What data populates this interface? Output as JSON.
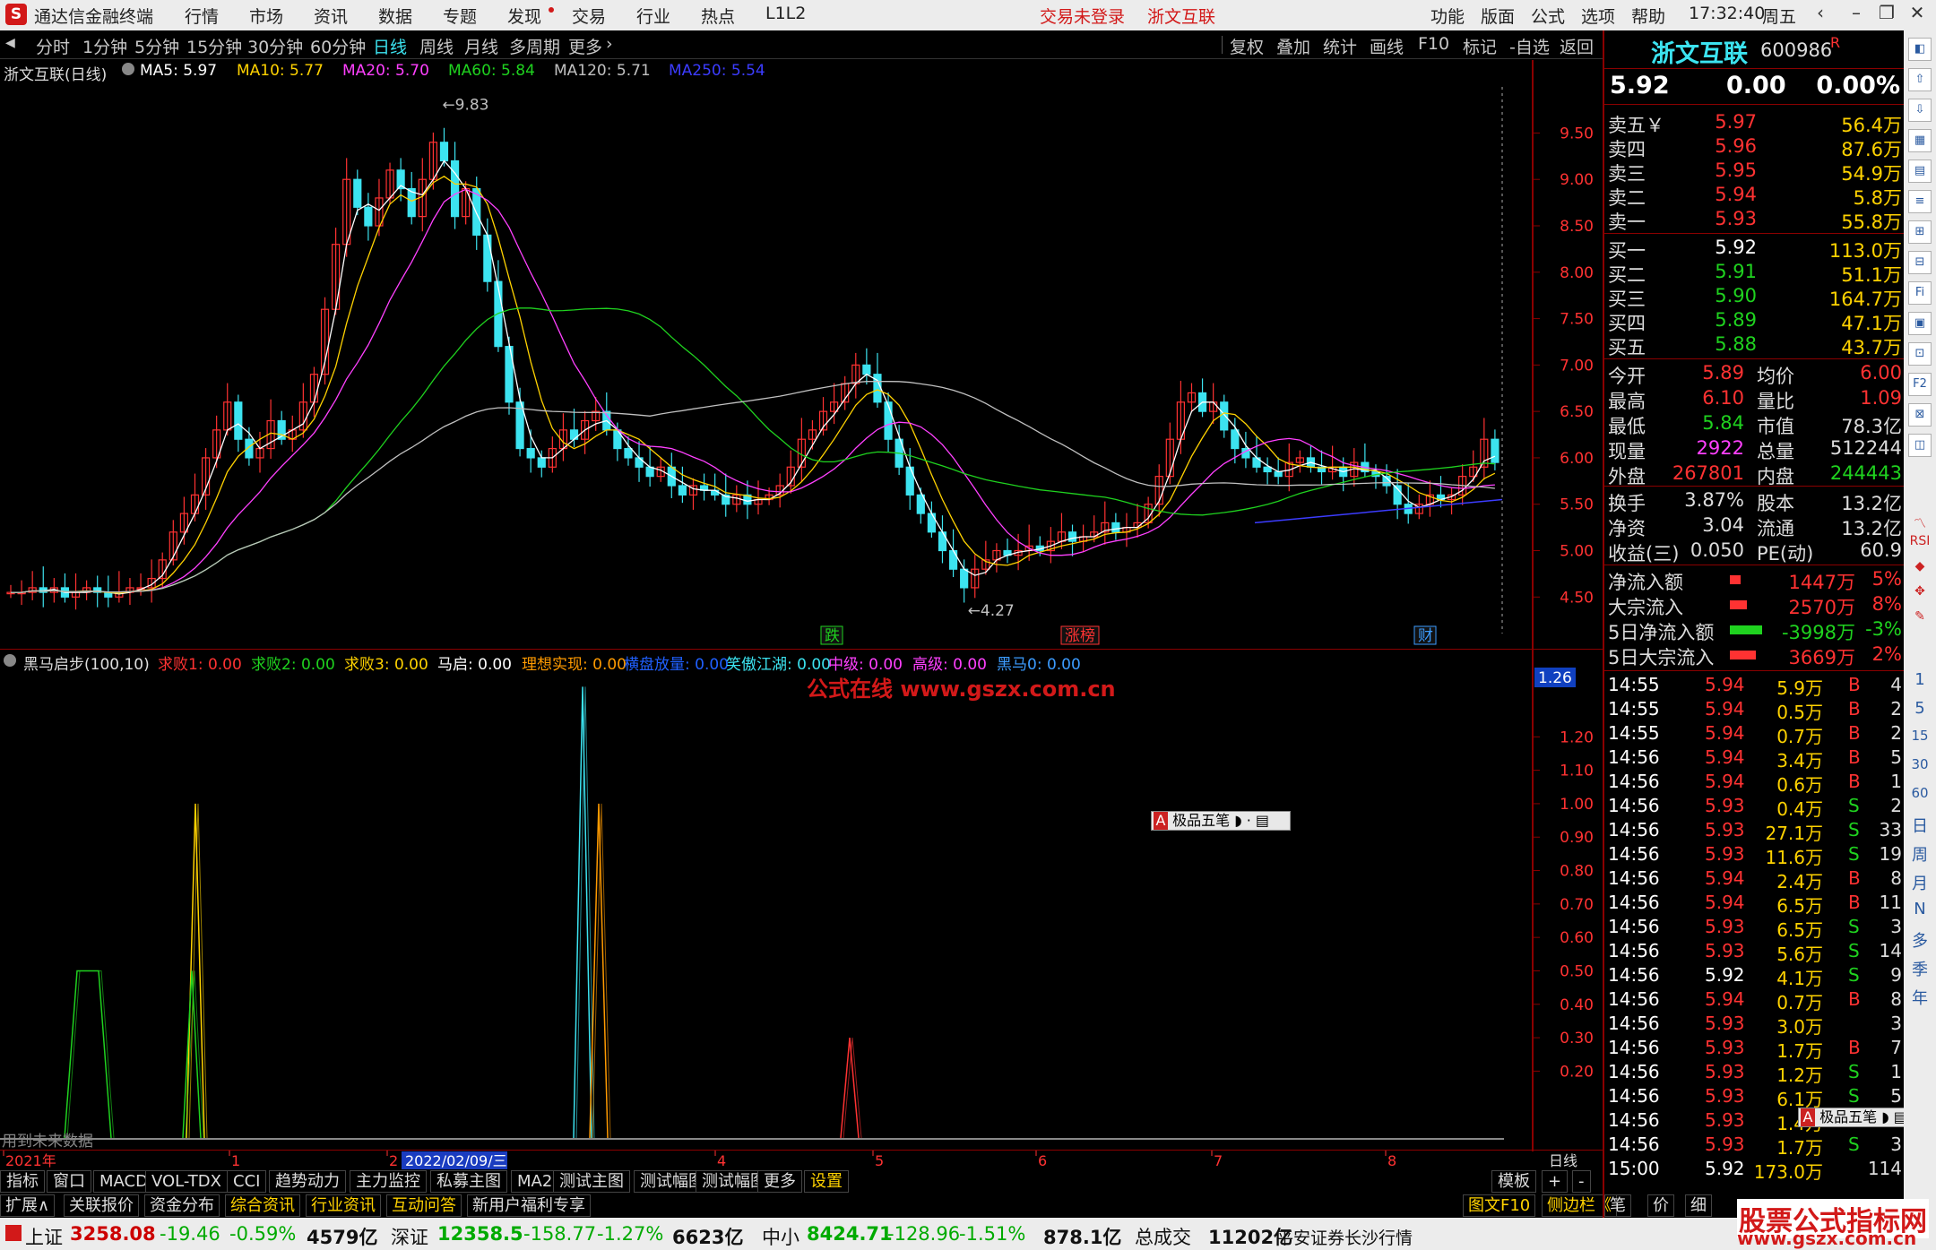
{
  "app": {
    "title": "通达信金融终端",
    "menu": [
      "行情",
      "市场",
      "资讯",
      "数据",
      "专题",
      "发现",
      "交易",
      "行业",
      "热点",
      "L1L2"
    ],
    "trade_status": "交易未登录",
    "broker_name": "浙文互联",
    "right_menu": [
      "功能",
      "版面",
      "公式",
      "选项",
      "帮助"
    ],
    "clock": "17:32:40",
    "weekday": "周五"
  },
  "toolbar": {
    "periods": [
      "分时",
      "1分钟",
      "5分钟",
      "15分钟",
      "30分钟",
      "60分钟",
      "日线",
      "周线",
      "月线",
      "多周期",
      "更多"
    ],
    "active_period": "日线",
    "right_buttons": [
      "复权",
      "叠加",
      "统计",
      "画线",
      "F10",
      "标记",
      "-自选",
      "返回"
    ]
  },
  "main_chart": {
    "header": "浙文互联(日线)",
    "ma": [
      {
        "label": "MA5: 5.97",
        "color": "#ffffff"
      },
      {
        "label": "MA10: 5.77",
        "color": "#ffd200"
      },
      {
        "label": "MA20: 5.70",
        "color": "#ff40ff"
      },
      {
        "label": "MA60: 5.84",
        "color": "#1fd21f"
      },
      {
        "label": "MA120: 5.71",
        "color": "#c0c0c0"
      },
      {
        "label": "MA250: 5.54",
        "color": "#3c3cff"
      }
    ],
    "y_ticks": [
      "9.50",
      "9.00",
      "8.50",
      "8.00",
      "7.50",
      "7.00",
      "6.50",
      "6.00",
      "5.50",
      "5.00",
      "4.50"
    ],
    "high_label": "9.83",
    "low_label": "4.27",
    "markers": [
      "跌",
      "涨榜",
      "财"
    ],
    "watermark": "公式在线 www.gszx.com.cn"
  },
  "indicator": {
    "header": "黑马启步(100,10)",
    "items": [
      {
        "label": "求败1: 0.00",
        "color": "#ff3232"
      },
      {
        "label": "求败2: 0.00",
        "color": "#1fd21f"
      },
      {
        "label": "求败3: 0.00",
        "color": "#ffd200"
      },
      {
        "label": "马启: 0.00",
        "color": "#ffffff"
      },
      {
        "label": "理想实现: 0.00",
        "color": "#ff9a00"
      },
      {
        "label": "横盘放量: 0.00",
        "color": "#2060ff"
      },
      {
        "label": "笑傲江湖: 0.00",
        "color": "#3ce3f0"
      },
      {
        "label": "中级: 0.00",
        "color": "#ff40ff"
      },
      {
        "label": "高级: 0.00",
        "color": "#ff40ff"
      },
      {
        "label": "黑马0: 0.00",
        "color": "#3c9cff"
      }
    ],
    "current_value": "1.26",
    "y_ticks": [
      "1.20",
      "1.10",
      "1.00",
      "0.90",
      "0.80",
      "0.70",
      "0.60",
      "0.50",
      "0.40",
      "0.30",
      "0.20"
    ],
    "footer_note": "用到未来数据",
    "float_toolbar": "极品五笔"
  },
  "date_axis": {
    "labels": [
      "2021年",
      "1",
      "2",
      "4",
      "5",
      "6",
      "7",
      "8"
    ],
    "cursor_date": "2022/02/09/三",
    "right_label": "日线"
  },
  "tabs": [
    "指标",
    "窗口",
    "MACD",
    "VOL-TDX",
    "CCI",
    "趋势动力",
    "主力监控",
    "私募主图",
    "MA2",
    "测试主图",
    "测试幅图A",
    "测试幅图B",
    "更多",
    "设置"
  ],
  "tabs_right": [
    "模板",
    "+",
    "-"
  ],
  "tabs2": [
    "扩展∧",
    "关联报价",
    "资金分布",
    "综合资讯",
    "行业资讯",
    "互动问答",
    "新用户福利专享"
  ],
  "tabs2_right": [
    "图文F10",
    "侧边栏《",
    "笔",
    "价",
    "细"
  ],
  "stock": {
    "name": "浙文互联",
    "code": "600986",
    "tag": "R",
    "price": "5.92",
    "change": "0.00",
    "change_pct": "0.00%",
    "asks": [
      {
        "label": "卖五￥",
        "price": "5.97",
        "vol": "56.4万"
      },
      {
        "label": "卖四",
        "price": "5.96",
        "vol": "87.6万"
      },
      {
        "label": "卖三",
        "price": "5.95",
        "vol": "54.9万"
      },
      {
        "label": "卖二",
        "price": "5.94",
        "vol": "5.8万"
      },
      {
        "label": "卖一",
        "price": "5.93",
        "vol": "55.8万"
      }
    ],
    "bids": [
      {
        "label": "买一",
        "price": "5.92",
        "vol": "113.0万"
      },
      {
        "label": "买二",
        "price": "5.91",
        "vol": "51.1万"
      },
      {
        "label": "买三",
        "price": "5.90",
        "vol": "164.7万"
      },
      {
        "label": "买四",
        "price": "5.89",
        "vol": "47.1万"
      },
      {
        "label": "买五",
        "price": "5.88",
        "vol": "43.7万"
      }
    ],
    "stats": [
      {
        "l1": "今开",
        "v1": "5.89",
        "c1": "#ff3232",
        "l2": "均价",
        "v2": "6.00",
        "c2": "#ff3232"
      },
      {
        "l1": "最高",
        "v1": "6.10",
        "c1": "#ff3232",
        "l2": "量比",
        "v2": "1.09",
        "c2": "#ff3232"
      },
      {
        "l1": "最低",
        "v1": "5.84",
        "c1": "#1fd21f",
        "l2": "市值",
        "v2": "78.3亿",
        "c2": "#dddddd"
      },
      {
        "l1": "现量",
        "v1": "2922",
        "c1": "#ff40ff",
        "l2": "总量",
        "v2": "512244",
        "c2": "#dddddd"
      },
      {
        "l1": "外盘",
        "v1": "267801",
        "c1": "#ff3232",
        "l2": "内盘",
        "v2": "244443",
        "c2": "#1fd21f"
      }
    ],
    "stats2": [
      {
        "l1": "换手",
        "v1": "3.87%",
        "l2": "股本",
        "v2": "13.2亿"
      },
      {
        "l1": "净资",
        "v1": "3.04",
        "l2": "流通",
        "v2": "13.2亿"
      },
      {
        "l1": "收益(三)",
        "v1": "0.050",
        "l2": "PE(动)",
        "v2": "60.9"
      }
    ],
    "flows": [
      {
        "label": "净流入额",
        "value": "1447万",
        "pct": "5%",
        "color": "#ff3232",
        "bar": 0.05
      },
      {
        "label": "大宗流入",
        "value": "2570万",
        "pct": "8%",
        "color": "#ff3232",
        "bar": 0.08
      },
      {
        "label": "5日净流入额",
        "value": "-3998万",
        "pct": "-3%",
        "color": "#1fd21f",
        "bar": 0.15
      },
      {
        "label": "5日大宗流入",
        "value": "3669万",
        "pct": "2%",
        "color": "#ff3232",
        "bar": 0.12
      }
    ],
    "ticks": [
      {
        "t": "14:55",
        "p": "5.94",
        "v": "5.9万",
        "s": "B",
        "n": "4"
      },
      {
        "t": "14:55",
        "p": "5.94",
        "v": "0.5万",
        "s": "B",
        "n": "2"
      },
      {
        "t": "14:55",
        "p": "5.94",
        "v": "0.7万",
        "s": "B",
        "n": "2"
      },
      {
        "t": "14:56",
        "p": "5.94",
        "v": "3.4万",
        "s": "B",
        "n": "5"
      },
      {
        "t": "14:56",
        "p": "5.94",
        "v": "0.6万",
        "s": "B",
        "n": "1"
      },
      {
        "t": "14:56",
        "p": "5.93",
        "v": "0.4万",
        "s": "S",
        "n": "2"
      },
      {
        "t": "14:56",
        "p": "5.93",
        "v": "27.1万",
        "s": "S",
        "n": "33"
      },
      {
        "t": "14:56",
        "p": "5.93",
        "v": "11.6万",
        "s": "S",
        "n": "19"
      },
      {
        "t": "14:56",
        "p": "5.94",
        "v": "2.4万",
        "s": "B",
        "n": "8"
      },
      {
        "t": "14:56",
        "p": "5.94",
        "v": "6.5万",
        "s": "B",
        "n": "11"
      },
      {
        "t": "14:56",
        "p": "5.93",
        "v": "6.5万",
        "s": "S",
        "n": "3"
      },
      {
        "t": "14:56",
        "p": "5.93",
        "v": "5.6万",
        "s": "S",
        "n": "14"
      },
      {
        "t": "14:56",
        "p": "5.92",
        "v": "4.1万",
        "s": "S",
        "n": "9"
      },
      {
        "t": "14:56",
        "p": "5.94",
        "v": "0.7万",
        "s": "B",
        "n": "8"
      },
      {
        "t": "14:56",
        "p": "5.93",
        "v": "3.0万",
        "s": "",
        "n": "3"
      },
      {
        "t": "14:56",
        "p": "5.93",
        "v": "1.7万",
        "s": "B",
        "n": "7"
      },
      {
        "t": "14:56",
        "p": "5.93",
        "v": "1.2万",
        "s": "S",
        "n": "1"
      },
      {
        "t": "14:56",
        "p": "5.93",
        "v": "6.1万",
        "s": "S",
        "n": "5"
      },
      {
        "t": "14:56",
        "p": "5.93",
        "v": "1.4万",
        "s": "",
        "n": ""
      },
      {
        "t": "14:56",
        "p": "5.93",
        "v": "1.7万",
        "s": "S",
        "n": "3"
      },
      {
        "t": "15:00",
        "p": "5.92",
        "v": "173.0万",
        "s": "",
        "n": "114"
      }
    ]
  },
  "side_tools": [
    "1",
    "5",
    "15",
    "30",
    "60",
    "日",
    "周",
    "月",
    "N",
    "多",
    "季",
    "年"
  ],
  "status": {
    "items": [
      {
        "name": "上证",
        "value": "3258.08",
        "chg": "-19.46",
        "pct": "-0.59%",
        "amt": "4579亿"
      },
      {
        "name": "深证",
        "value": "12358.5",
        "chg": "-158.77",
        "pct": "-1.27%",
        "amt": "6623亿"
      },
      {
        "name": "中小",
        "value": "8424.71",
        "chg": "-128.96",
        "pct": "-1.51%",
        "amt": "878.1亿"
      }
    ],
    "total_label": "总成交",
    "total_value": "11202亿",
    "broker_line": "平安证券长沙行情"
  },
  "corner_watermark": "股票公式指标网",
  "corner_watermark_url": "www.gszx.com.cn"
}
